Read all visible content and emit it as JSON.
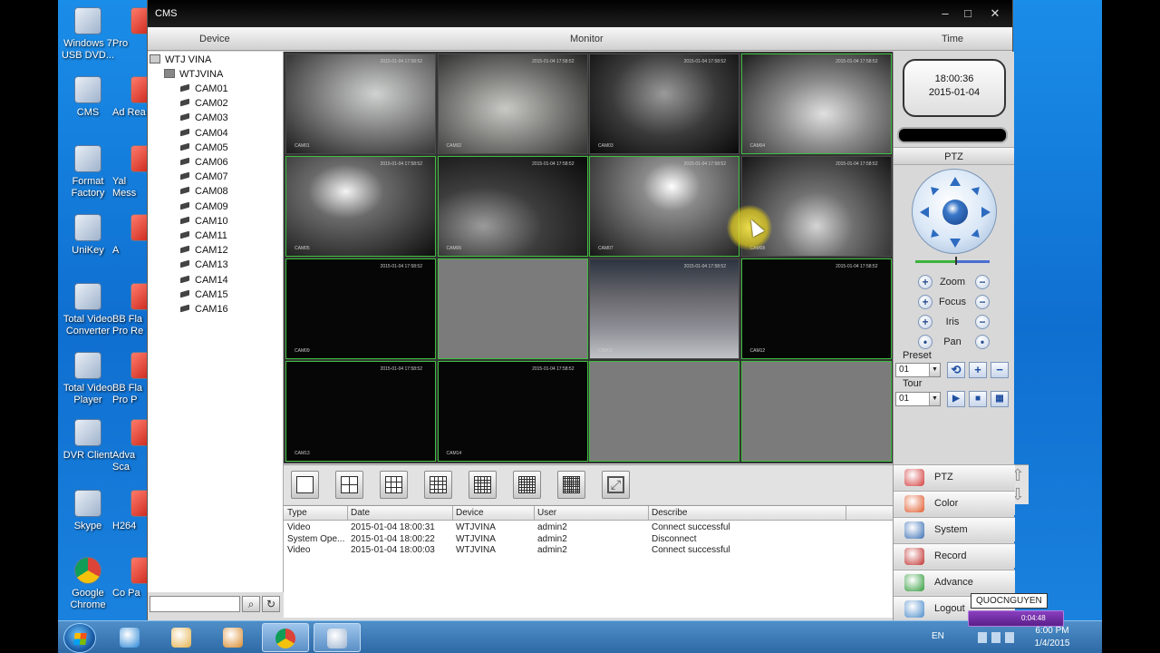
{
  "desktop": {
    "icons": [
      {
        "label": "Windows 7 USB DVD...",
        "icon": "usb-dvd-tool-icon"
      },
      {
        "label": "CMS",
        "icon": "cms-icon"
      },
      {
        "label": "Format Factory",
        "icon": "format-factory-icon"
      },
      {
        "label": "UniKey",
        "icon": "unikey-icon"
      },
      {
        "label": "Total Video Converter",
        "icon": "video-converter-icon"
      },
      {
        "label": "Total Video Player",
        "icon": "video-player-icon"
      },
      {
        "label": "DVR Client",
        "icon": "dvr-client-icon"
      },
      {
        "label": "Skype",
        "icon": "skype-icon"
      },
      {
        "label": "Google Chrome",
        "icon": "chrome-icon"
      }
    ],
    "icons_col2": [
      {
        "label": "Pro",
        "icon": "app-icon"
      },
      {
        "label": "Ad Rea",
        "icon": "adobe-reader-icon"
      },
      {
        "label": "Yal Mess",
        "icon": "yahoo-messenger-icon"
      },
      {
        "label": "A",
        "icon": "app-icon"
      },
      {
        "label": "BB Fla Pro Re",
        "icon": "flashback-icon"
      },
      {
        "label": "BB Fla Pro P",
        "icon": "flashback-icon"
      },
      {
        "label": "Adva Sca",
        "icon": "scanner-icon"
      },
      {
        "label": "H264",
        "icon": "h264-icon"
      },
      {
        "label": "Co Pa",
        "icon": "control-panel-icon"
      }
    ]
  },
  "window": {
    "title": "CMS",
    "minimize": "–",
    "maximize": "□",
    "close": "✕",
    "header": {
      "device": "Device",
      "monitor": "Monitor",
      "time": "Time"
    }
  },
  "tree": {
    "root": "WTJ VINA",
    "device": "WTJVINA",
    "cameras": [
      "CAM01",
      "CAM02",
      "CAM03",
      "CAM04",
      "CAM05",
      "CAM06",
      "CAM07",
      "CAM08",
      "CAM09",
      "CAM10",
      "CAM11",
      "CAM12",
      "CAM13",
      "CAM14",
      "CAM15",
      "CAM16"
    ]
  },
  "monitor": {
    "timestamp": "2015-01-04 17:58:52",
    "cells": [
      {
        "name": "CAM01",
        "state": "video"
      },
      {
        "name": "CAM02",
        "state": "video"
      },
      {
        "name": "CAM03",
        "state": "video"
      },
      {
        "name": "CAM04",
        "state": "video"
      },
      {
        "name": "CAM05",
        "state": "video"
      },
      {
        "name": "CAM06",
        "state": "video"
      },
      {
        "name": "CAM07",
        "state": "video"
      },
      {
        "name": "CAM08",
        "state": "video"
      },
      {
        "name": "CAM09",
        "state": "dark"
      },
      {
        "name": "CAM10",
        "state": "empty"
      },
      {
        "name": "CAM11",
        "state": "video"
      },
      {
        "name": "CAM12",
        "state": "dark"
      },
      {
        "name": "CAM13",
        "state": "dark"
      },
      {
        "name": "CAM14",
        "state": "dark"
      },
      {
        "name": "CAM15",
        "state": "empty"
      },
      {
        "name": "CAM16",
        "state": "empty"
      }
    ]
  },
  "layouts": [
    "1",
    "4",
    "9",
    "16",
    "25",
    "36",
    "64",
    "fullscreen"
  ],
  "log": {
    "columns": [
      "Type",
      "Date",
      "Device",
      "User",
      "Describe"
    ],
    "rows": [
      [
        "Video",
        "2015-01-04 18:00:31",
        "WTJVINA",
        "admin2",
        "Connect successful"
      ],
      [
        "System Ope...",
        "2015-01-04 18:00:22",
        "WTJVINA",
        "admin2",
        "Disconnect"
      ],
      [
        "Video",
        "2015-01-04 18:00:03",
        "WTJVINA",
        "admin2",
        "Connect successful"
      ]
    ]
  },
  "clock": {
    "time": "18:00:36",
    "date": "2015-01-04"
  },
  "ptz": {
    "title": "PTZ",
    "controls": [
      "Zoom",
      "Focus",
      "Iris",
      "Pan"
    ],
    "preset_label": "Preset",
    "preset_value": "01",
    "tour_label": "Tour",
    "tour_value": "01"
  },
  "menu": [
    {
      "label": "PTZ",
      "color": "#d33a3a"
    },
    {
      "label": "Color",
      "color": "#e0592a"
    },
    {
      "label": "System",
      "color": "#3a6fb5"
    },
    {
      "label": "Record",
      "color": "#c0302e"
    },
    {
      "label": "Advance",
      "color": "#2f9b3a"
    },
    {
      "label": "Logout",
      "color": "#4a8bc9"
    }
  ],
  "taskbar": {
    "lang": "EN",
    "time": "6:00 PM",
    "date": "1/4/2015",
    "tooltip": "QUOCNGUYEN",
    "media_time": "0:04:48",
    "apps": [
      "internet-explorer-icon",
      "file-explorer-icon",
      "media-player-icon",
      "chrome-icon",
      "cms-icon"
    ]
  }
}
